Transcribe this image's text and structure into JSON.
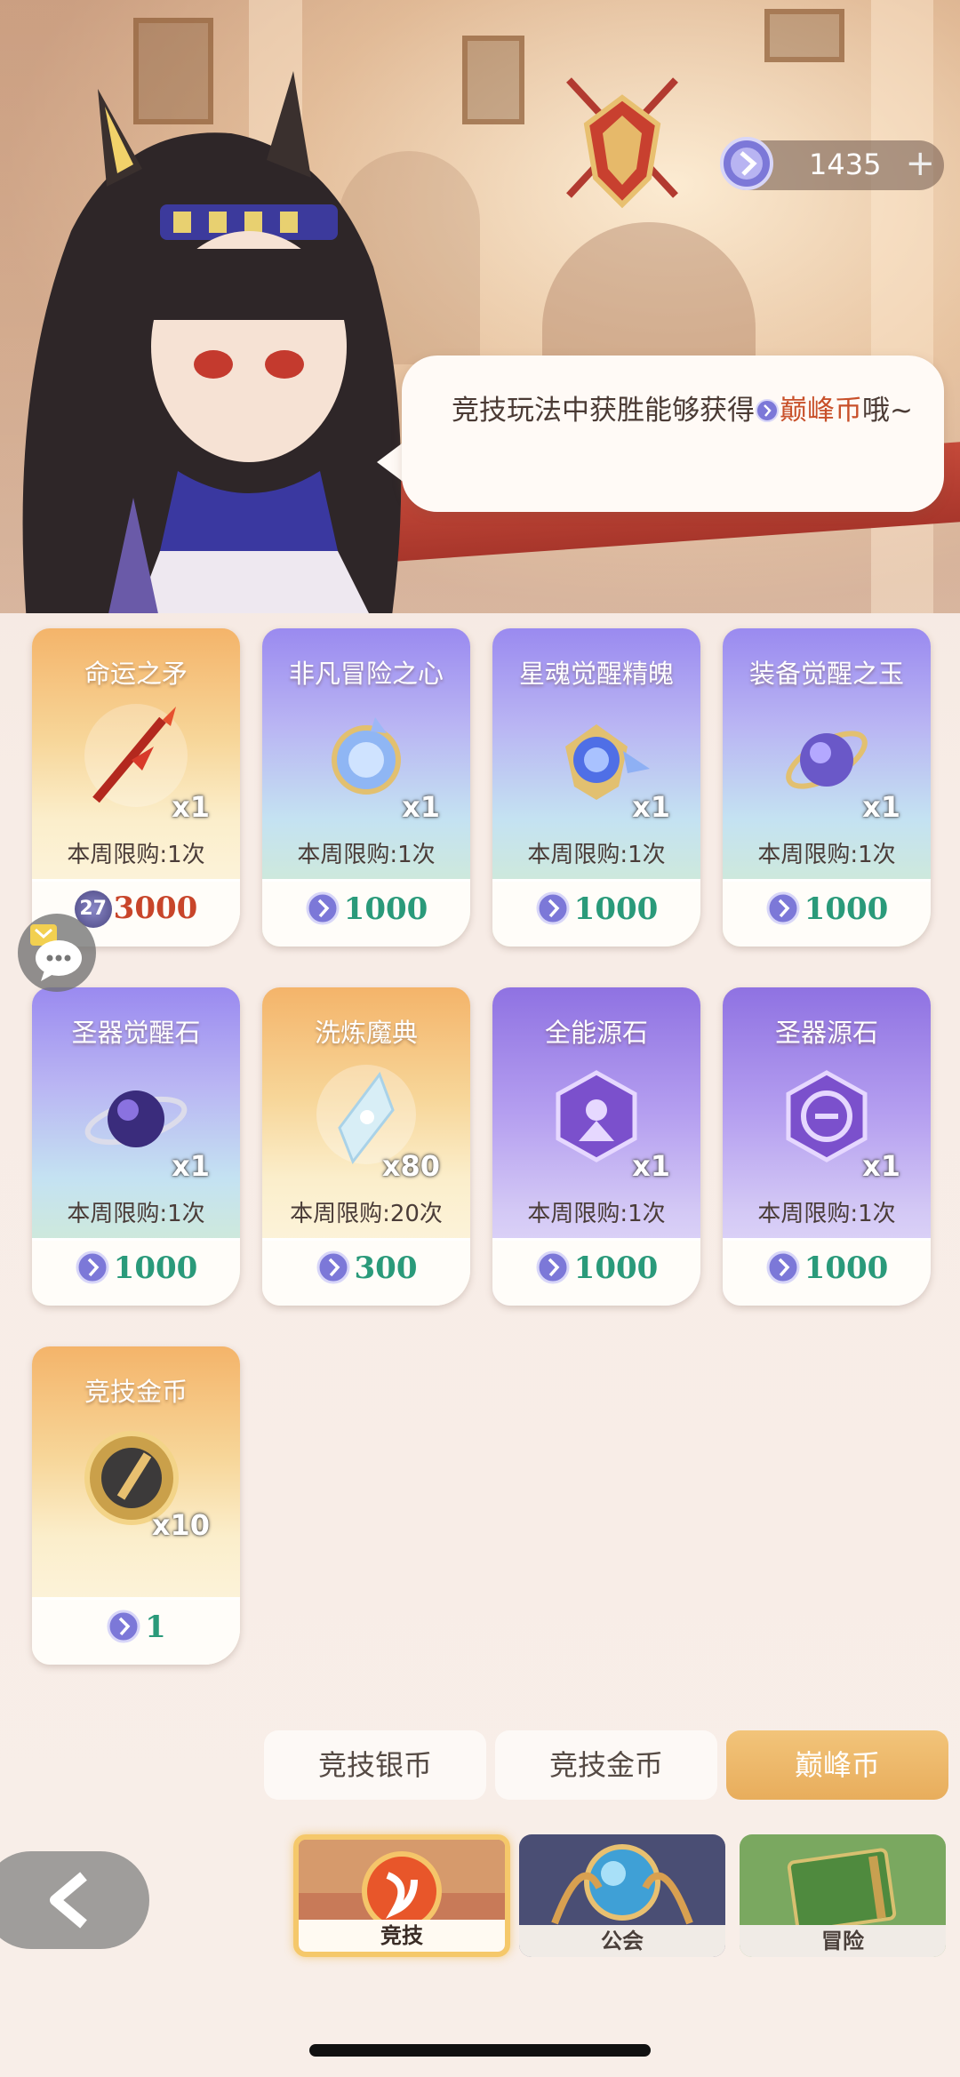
{
  "header": {
    "currency_icon": "peak-coin-icon",
    "currency_amount": "1435",
    "add_label": "+"
  },
  "dialogue": {
    "text_prefix": "竞技玩法中获胜能够获得",
    "text_highlight": "巅峰币",
    "text_suffix": "哦~"
  },
  "shop": {
    "items": [
      {
        "name": "命运之矛",
        "qty": "x1",
        "limit": "本周限购:1次",
        "owned": "27",
        "price": "3000",
        "price_style": "red",
        "icon": "spear-icon"
      },
      {
        "name": "非凡冒险之心",
        "qty": "x1",
        "limit": "本周限购:1次",
        "price": "1000",
        "icon": "heart-crystal-icon"
      },
      {
        "name": "星魂觉醒精魄",
        "qty": "x1",
        "limit": "本周限购:1次",
        "price": "1000",
        "icon": "star-soul-icon"
      },
      {
        "name": "装备觉醒之玉",
        "qty": "x1",
        "limit": "本周限购:1次",
        "price": "1000",
        "icon": "jade-orb-icon"
      },
      {
        "name": "圣器觉醒石",
        "qty": "x1",
        "limit": "本周限购:1次",
        "price": "1000",
        "icon": "galaxy-orb-icon"
      },
      {
        "name": "洗炼魔典",
        "qty": "x80",
        "limit": "本周限购:20次",
        "price": "300",
        "icon": "crystal-shard-icon"
      },
      {
        "name": "全能源石",
        "qty": "x1",
        "limit": "本周限购:1次",
        "price": "1000",
        "icon": "hexagon-stone-icon"
      },
      {
        "name": "圣器源石",
        "qty": "x1",
        "limit": "本周限购:1次",
        "price": "1000",
        "icon": "hexagon-rune-icon"
      },
      {
        "name": "竞技金币",
        "qty": "x10",
        "limit": "",
        "price": "1",
        "icon": "gold-coin-icon"
      }
    ]
  },
  "currency_tabs": [
    {
      "label": "竞技银币",
      "active": false
    },
    {
      "label": "竞技金币",
      "active": false
    },
    {
      "label": "巅峰币",
      "active": true
    }
  ],
  "modes": [
    {
      "label": "竞技",
      "active": true
    },
    {
      "label": "公会",
      "active": false
    },
    {
      "label": "冒险",
      "active": false
    }
  ],
  "colors": {
    "accent": "#e8ad5c",
    "price_green": "#2a9a7a",
    "price_red": "#c8452a",
    "highlight": "#c8502a"
  }
}
